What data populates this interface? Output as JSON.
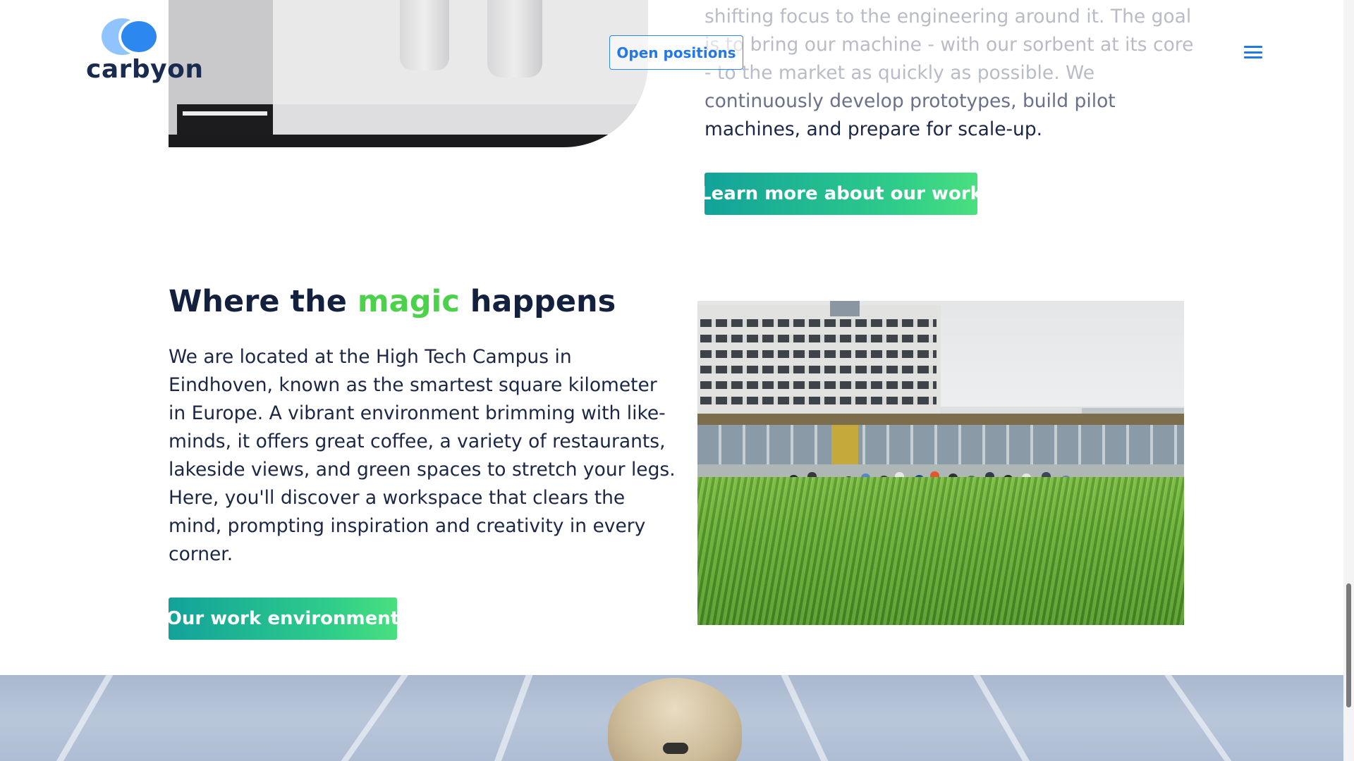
{
  "header": {
    "logo_text": "carbyon",
    "open_positions_label": "Open positions",
    "menu_icon": "hamburger-menu-icon"
  },
  "intro": {
    "lines": [
      "shifting focus to the engineering around it. The goal",
      "is to bring our machine - with our sorbent at its core",
      "- to the market as quickly as possible. We",
      "continuously develop prototypes, build pilot",
      "machines, and prepare for scale-up."
    ],
    "cta_label": "Learn more about our work"
  },
  "magic": {
    "title_before": "Where the",
    "title_accent": "magic",
    "title_after": "happens",
    "body_lines": [
      "We are located at the High Tech Campus in",
      "Eindhoven, known as the smartest square kilometer",
      "in Europe. A vibrant environment brimming with like-",
      "minds, it offers great coffee, a variety of restaurants,",
      "lakeside views, and green spaces to stretch your legs.",
      "Here, you'll discover a workspace that clears the",
      "mind, prompting inspiration and creativity in every",
      "corner."
    ],
    "cta_label": "Our work environment"
  },
  "colors": {
    "navy": "#13213f",
    "brand_blue": "#2378e8",
    "accent_green": "#4cd14a",
    "button_gradient_start": "#12a29a",
    "button_gradient_end": "#49e07f"
  }
}
